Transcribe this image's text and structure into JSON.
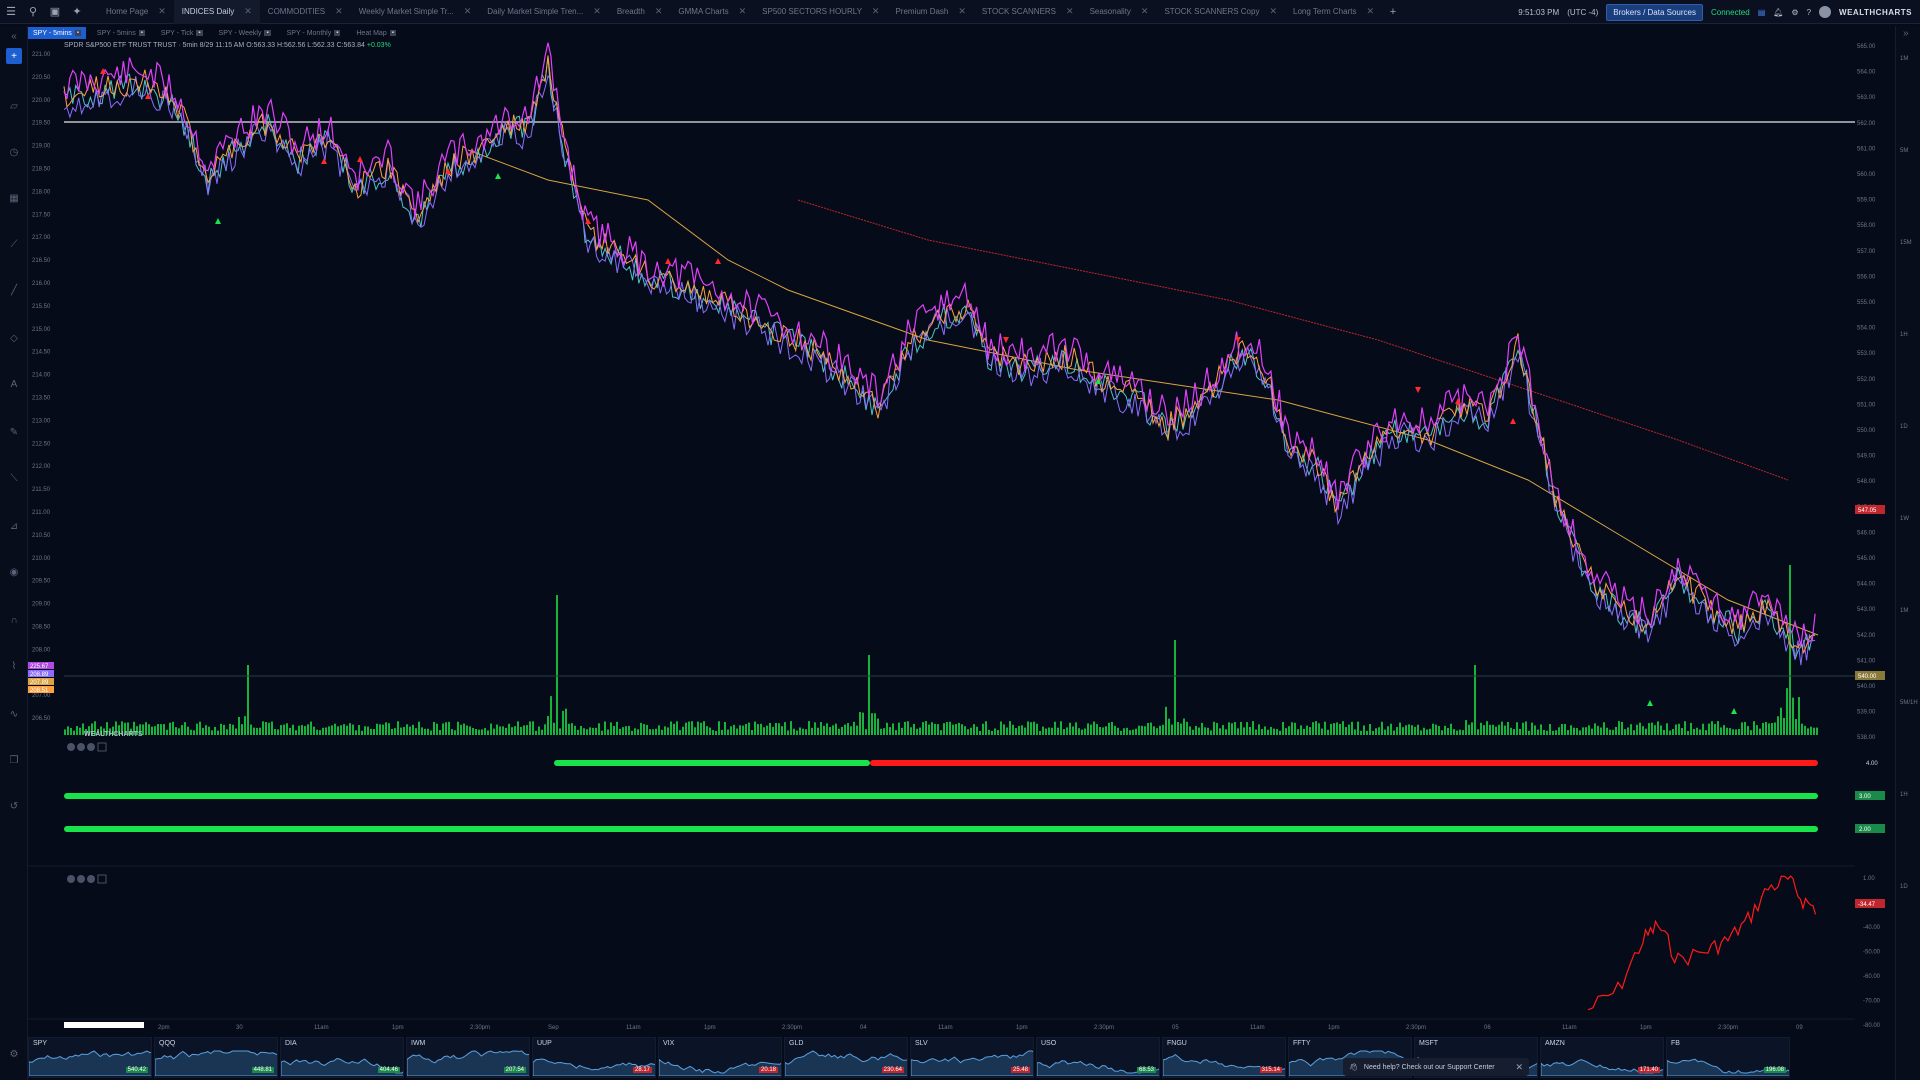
{
  "topbar": {
    "tabs": [
      {
        "label": "Home Page",
        "active": false
      },
      {
        "label": "INDICES Daily",
        "active": true
      },
      {
        "label": "COMMODITIES",
        "active": false
      },
      {
        "label": "Weekly Market Simple Tr...",
        "active": false
      },
      {
        "label": "Daily Market Simple Tren...",
        "active": false
      },
      {
        "label": "Breadth",
        "active": false
      },
      {
        "label": "GMMA Charts",
        "active": false
      },
      {
        "label": "SP500 SECTORS HOURLY",
        "active": false
      },
      {
        "label": "Premium Dash",
        "active": false
      },
      {
        "label": "STOCK SCANNERS",
        "active": false
      },
      {
        "label": "Seasonality",
        "active": false
      },
      {
        "label": "STOCK SCANNERS Copy",
        "active": false
      },
      {
        "label": "Long Term Charts",
        "active": false
      }
    ],
    "time": "9:51:03 PM",
    "timezone": "(UTC -4)",
    "broker_button": "Brokers / Data Sources",
    "connection_status": "Connected",
    "brand": "WEALTHCHARTS"
  },
  "chart_tabs": [
    {
      "label": "SPY - 5mins",
      "active": true
    },
    {
      "label": "SPY - 5mins",
      "active": false
    },
    {
      "label": "SPY - Tick",
      "active": false
    },
    {
      "label": "SPY - Weekly",
      "active": false
    },
    {
      "label": "SPY - Monthly",
      "active": false
    },
    {
      "label": "Heat Map",
      "active": false
    }
  ],
  "ohlc": {
    "symbol_line": "SPDR S&P500 ETF TRUST TRUST · 5min 8/29 11:15 AM O:563.33 H:562.56 L:562.33 C:563.84",
    "change": "+0.03%"
  },
  "chart_data": {
    "type": "line",
    "left_axis_ticks": [
      "221.00",
      "220.50",
      "220.00",
      "219.50",
      "219.00",
      "218.50",
      "218.00",
      "217.50",
      "217.00",
      "216.50",
      "216.00",
      "215.50",
      "215.00",
      "214.50",
      "214.00",
      "213.50",
      "213.00",
      "212.50",
      "212.00",
      "211.50",
      "211.00",
      "210.50",
      "210.00",
      "209.50",
      "209.00",
      "208.50",
      "208.00",
      "207.50",
      "207.00",
      "206.50"
    ],
    "right_axis_ticks": [
      "565.00",
      "564.00",
      "563.00",
      "562.00",
      "561.00",
      "560.00",
      "559.00",
      "558.00",
      "557.00",
      "556.00",
      "555.00",
      "554.00",
      "553.00",
      "552.00",
      "551.00",
      "550.00",
      "549.00",
      "548.00",
      "547.00",
      "546.00",
      "545.00",
      "544.00",
      "543.00",
      "542.00",
      "541.00",
      "540.00",
      "539.00",
      "538.00"
    ],
    "x_ticks": [
      "2pm",
      "30",
      "11am",
      "1pm",
      "2:30pm",
      "Sep",
      "11am",
      "1pm",
      "2:30pm",
      "04",
      "11am",
      "1pm",
      "2:30pm",
      "05",
      "11am",
      "1pm",
      "2:30pm",
      "06",
      "11am",
      "1pm",
      "2:30pm",
      "09"
    ],
    "current_price_tag": "547.05",
    "left_price_tags": [
      "225.67",
      "208.89",
      "207.89",
      "208.51"
    ],
    "right_price_tag_low": "540.00",
    "indicator_pane_labels": [
      "4.00",
      "3.00",
      "2.00"
    ],
    "oscillator_ticks": [
      "1.00",
      "-30.00",
      "-40.00",
      "-50.00",
      "-60.00",
      "-70.00",
      "-80.00"
    ],
    "oscillator_value": "-34.47",
    "right_side_labels": [
      "1M",
      "5M",
      "15M",
      "1H",
      "1D",
      "1W",
      "1M",
      "5M/1H",
      "1H",
      "1D"
    ]
  },
  "watermark": "WEALTHCHARTS",
  "watchlist": [
    {
      "symbol": "SPY",
      "price": "540.42",
      "dir": "up"
    },
    {
      "symbol": "QQQ",
      "price": "448.81",
      "dir": "up"
    },
    {
      "symbol": "DIA",
      "price": "404.46",
      "dir": "up"
    },
    {
      "symbol": "IWM",
      "price": "207.54",
      "dir": "up"
    },
    {
      "symbol": "UUP",
      "price": "28.17",
      "dir": "down"
    },
    {
      "symbol": "VIX",
      "price": "20.18",
      "dir": "down"
    },
    {
      "symbol": "GLD",
      "price": "230.64",
      "dir": "down"
    },
    {
      "symbol": "SLV",
      "price": "25.48",
      "dir": "down"
    },
    {
      "symbol": "USO",
      "price": "68.53",
      "dir": "up"
    },
    {
      "symbol": "FNGU",
      "price": "315.14",
      "dir": "down"
    },
    {
      "symbol": "FFTY",
      "price": "",
      "dir": "up"
    },
    {
      "symbol": "MSFT",
      "price": "",
      "dir": "up"
    },
    {
      "symbol": "AMZN",
      "price": "171.40",
      "dir": "down"
    },
    {
      "symbol": "FB",
      "price": "196.08",
      "dir": "up"
    }
  ],
  "support_toast": {
    "text": "Need help? Check out our Support Center"
  },
  "colors": {
    "bg": "#050b18",
    "green": "#19e34a",
    "red": "#ff1a1a",
    "magenta": "#e040fb",
    "orange": "#ffa040",
    "purple": "#8c6cff",
    "cyan": "#4fc3c8",
    "ma_gold": "#d9a441",
    "ma_red": "#c0262d",
    "accent_blue": "#1d5fd1"
  }
}
